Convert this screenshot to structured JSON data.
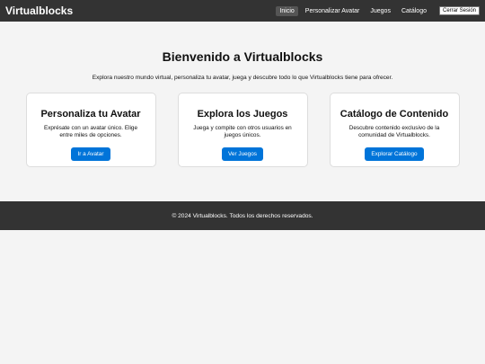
{
  "nav": {
    "brand": "Virtualblocks",
    "links": [
      "Inicio",
      "Personalizar Avatar",
      "Juegos",
      "Catálogo"
    ],
    "logout": "Cerrar Sesión"
  },
  "hero": {
    "title": "Bienvenido a Virtualblocks",
    "subtitle": "Explora nuestro mundo virtual, personaliza tu avatar, juega y descubre todo lo que Virtualblocks tiene para ofrecer."
  },
  "cards": [
    {
      "title": "Personaliza tu Avatar",
      "text": "Exprésate con un avatar único. Elige entre miles de opciones.",
      "button": "Ir a Avatar"
    },
    {
      "title": "Explora los Juegos",
      "text": "Juega y compite con otros usuarios en juegos únicos.",
      "button": "Ver Juegos"
    },
    {
      "title": "Catálogo de Contenido",
      "text": "Descubre contenido exclusivo de la comunidad de Virtualblocks.",
      "button": "Explorar Catálogo"
    }
  ],
  "footer": {
    "text": "© 2024 Virtualblocks. Todos los derechos reservados."
  },
  "colors": {
    "navbar": "#333333",
    "accent": "#0074d9",
    "background": "#f4f4f4"
  }
}
